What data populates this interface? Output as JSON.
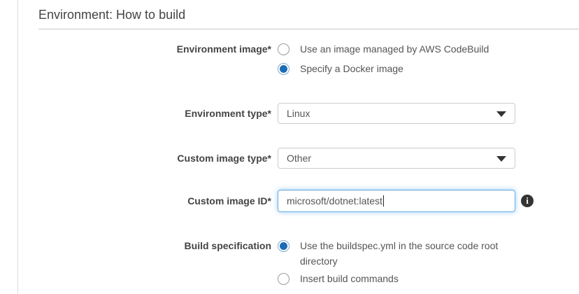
{
  "section": {
    "title": "Environment: How to build"
  },
  "form": {
    "environment_image": {
      "label": "Environment image*",
      "options": [
        {
          "label": "Use an image managed by AWS CodeBuild",
          "selected": false
        },
        {
          "label": "Specify a Docker image",
          "selected": true
        }
      ]
    },
    "environment_type": {
      "label": "Environment type*",
      "value": "Linux"
    },
    "custom_image_type": {
      "label": "Custom image type*",
      "value": "Other"
    },
    "custom_image_id": {
      "label": "Custom image ID*",
      "value": "microsoft/dotnet:latest"
    },
    "build_specification": {
      "label": "Build specification",
      "options": [
        {
          "label": "Use the buildspec.yml in the source code root directory",
          "selected": true
        },
        {
          "label": "Insert build commands",
          "selected": false
        }
      ]
    }
  },
  "icons": {
    "info_glyph": "i"
  },
  "colors": {
    "accent_blue": "#1a6cb8",
    "focus_border": "#66afe9",
    "control_border": "#cccccc",
    "divider": "#cccccc",
    "label_text": "#444444",
    "body_text": "#555555"
  }
}
